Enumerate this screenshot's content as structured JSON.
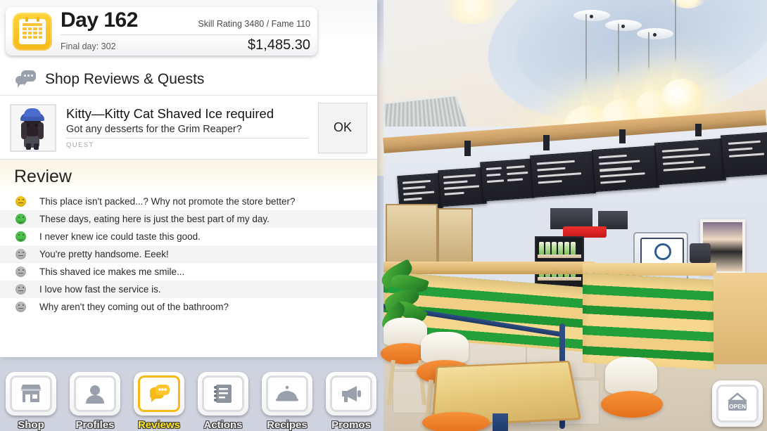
{
  "header": {
    "calendar_icon": "calendar-icon",
    "day_title": "Day 162",
    "final_day": "Final day: 302",
    "skill_fame": "Skill Rating 3480 / Fame 110",
    "money": "$1,485.30"
  },
  "section": {
    "icon": "speech-bubbles-icon",
    "title": "Shop Reviews & Quests"
  },
  "quest": {
    "avatar": "character-avatar",
    "title": "Kitty—Kitty Cat Shaved Ice required",
    "subtitle": "Got any desserts for the Grim Reaper?",
    "tag": "QUEST",
    "ok_label": "OK"
  },
  "review": {
    "heading": "Review",
    "items": [
      {
        "text": "This place isn't packed...? Why not promote the store better?",
        "mood": "neutral",
        "color": "#f0c419"
      },
      {
        "text": "These days, eating here is just the best part of my day.",
        "mood": "happy",
        "color": "#4cbf4c"
      },
      {
        "text": "I never knew ice could taste this good.",
        "mood": "happy",
        "color": "#4cbf4c"
      },
      {
        "text": "You're pretty handsome. Eeek!",
        "mood": "neutral",
        "color": "#b8b8bb"
      },
      {
        "text": "This shaved ice makes me smile...",
        "mood": "neutral",
        "color": "#b8b8bb"
      },
      {
        "text": "I love how fast the service is.",
        "mood": "neutral",
        "color": "#b8b8bb"
      },
      {
        "text": "Why aren't they coming out of the bathroom?",
        "mood": "neutral",
        "color": "#b8b8bb"
      }
    ]
  },
  "nav": {
    "items": [
      {
        "label": "Shop",
        "icon": "storefront-icon",
        "active": false
      },
      {
        "label": "Profiles",
        "icon": "person-icon",
        "active": false
      },
      {
        "label": "Reviews",
        "icon": "speech-bubble-icon",
        "active": true
      },
      {
        "label": "Actions",
        "icon": "notebook-icon",
        "active": false
      },
      {
        "label": "Recipes",
        "icon": "cloche-icon",
        "active": false
      },
      {
        "label": "Promos",
        "icon": "megaphone-icon",
        "active": false
      }
    ],
    "open_button": {
      "label": "OPEN",
      "icon": "open-sign-icon"
    }
  },
  "colors": {
    "accent_yellow": "#f7b916",
    "panel_white": "#ffffff",
    "counter_green": "#24a03a",
    "counter_yellow": "#f5d78d"
  }
}
